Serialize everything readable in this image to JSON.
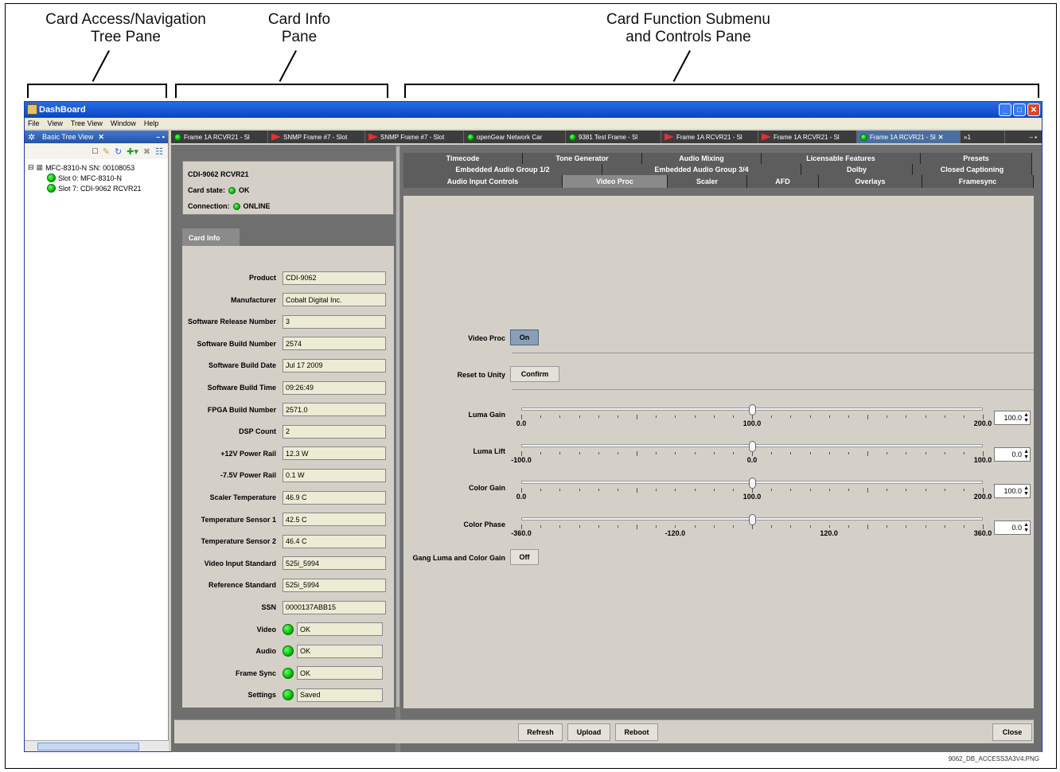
{
  "callouts": {
    "nav_tree": "Card Access/Navigation\nTree Pane",
    "card_info": "Card Info\nPane",
    "card_function": "Card Function Submenu\nand Controls Pane"
  },
  "filename": "9062_DB_ACCESS3A3V4.PNG",
  "window": {
    "title": "DashBoard",
    "menu": [
      "File",
      "View",
      "Tree View",
      "Window",
      "Help"
    ]
  },
  "tree": {
    "tab_label": "Basic Tree View",
    "root": "MFC-8310-N SN: 00108053",
    "slots": [
      "Slot 0: MFC-8310-N",
      "Slot 7: CDI-9062 RCVR21"
    ]
  },
  "doc_tabs": [
    {
      "label": "Frame 1A RCVR21 - Sl",
      "icon": "led"
    },
    {
      "label": "SNMP Frame #7 - Slot",
      "icon": "flag"
    },
    {
      "label": "SNMP Frame #7 - Slot",
      "icon": "flag"
    },
    {
      "label": "openGear Network Car",
      "icon": "led"
    },
    {
      "label": "9381 Test Frame - Sl",
      "icon": "led"
    },
    {
      "label": "Frame 1A RCVR21 - Sl",
      "icon": "flag"
    },
    {
      "label": "Frame 1A RCVR21 - Sl",
      "icon": "flag"
    },
    {
      "label": "Frame 1A RCVR21 - Sl",
      "icon": "led",
      "active": true
    }
  ],
  "doc_tabs_overflow": "»1",
  "card": {
    "name": "CDI-9062 RCVR21",
    "state_label": "Card state:",
    "state_value": "OK",
    "connection_label": "Connection:",
    "connection_value": "ONLINE",
    "info_tab": "Card Info"
  },
  "card_info_fields": [
    {
      "label": "Product",
      "value": "CDI-9062"
    },
    {
      "label": "Manufacturer",
      "value": "Cobalt Digital Inc."
    },
    {
      "label": "Software Release Number",
      "value": "3"
    },
    {
      "label": "Software Build Number",
      "value": "2574"
    },
    {
      "label": "Software Build Date",
      "value": "Jul 17 2009"
    },
    {
      "label": "Software Build Time",
      "value": "09:26:49"
    },
    {
      "label": "FPGA Build Number",
      "value": "2571.0"
    },
    {
      "label": "DSP Count",
      "value": "2"
    },
    {
      "label": "+12V Power Rail",
      "value": "12.3 W"
    },
    {
      "label": "-7.5V Power Rail",
      "value": "0.1 W"
    },
    {
      "label": "Scaler Temperature",
      "value": "46.9 C"
    },
    {
      "label": "Temperature Sensor 1",
      "value": "42.5 C"
    },
    {
      "label": "Temperature Sensor 2",
      "value": "46.4 C"
    },
    {
      "label": "Video Input Standard",
      "value": "525i_5994"
    },
    {
      "label": "Reference Standard",
      "value": "525i_5994"
    },
    {
      "label": "SSN",
      "value": "0000137ABB15"
    },
    {
      "label": "Video",
      "value": "OK",
      "led": true
    },
    {
      "label": "Audio",
      "value": "OK",
      "led": true
    },
    {
      "label": "Frame Sync",
      "value": "OK",
      "led": true
    },
    {
      "label": "Settings",
      "value": "Saved",
      "led": true
    }
  ],
  "control_tabs": {
    "row1": [
      "Timecode",
      "Tone Generator",
      "Audio Mixing",
      "Licensable Features",
      "Presets"
    ],
    "row2": [
      "Embedded Audio Group 1/2",
      "Embedded Audio Group 3/4",
      "Dolby",
      "Closed Captioning"
    ],
    "row3": [
      "Audio Input Controls",
      "Video Proc",
      "Scaler",
      "AFD",
      "Overlays",
      "Framesync"
    ],
    "active": "Video Proc"
  },
  "video_proc": {
    "video_proc_label": "Video Proc",
    "video_proc_value": "On",
    "reset_label": "Reset to Unity",
    "reset_button": "Confirm",
    "gang_label": "Gang Luma and Color Gain",
    "gang_value": "Off",
    "sliders": [
      {
        "label": "Luma Gain",
        "min": 0.0,
        "max": 200.0,
        "value": 100.0,
        "ticks": [
          "0.0",
          "100.0",
          "200.0"
        ],
        "display": "100.0"
      },
      {
        "label": "Luma Lift",
        "min": -100.0,
        "max": 100.0,
        "value": 0.0,
        "ticks": [
          "-100.0",
          "0.0",
          "100.0"
        ],
        "display": "0.0"
      },
      {
        "label": "Color Gain",
        "min": 0.0,
        "max": 200.0,
        "value": 100.0,
        "ticks": [
          "0.0",
          "100.0",
          "200.0"
        ],
        "display": "100.0"
      },
      {
        "label": "Color Phase",
        "min": -360.0,
        "max": 360.0,
        "value": 0.0,
        "ticks": [
          "-360.0",
          "-120.0",
          "120.0",
          "360.0"
        ],
        "display": "0.0"
      }
    ]
  },
  "bottom_buttons": {
    "refresh": "Refresh",
    "upload": "Upload",
    "reboot": "Reboot",
    "close": "Close"
  }
}
